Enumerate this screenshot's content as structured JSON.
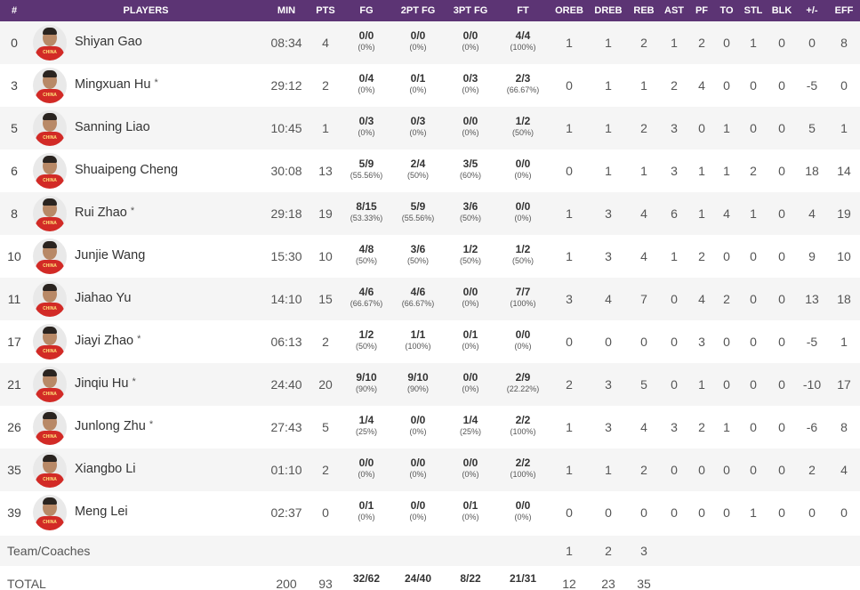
{
  "columns": [
    "#",
    "PLAYERS",
    "MIN",
    "PTS",
    "FG",
    "2PT FG",
    "3PT FG",
    "FT",
    "OREB",
    "DREB",
    "REB",
    "AST",
    "PF",
    "TO",
    "STL",
    "BLK",
    "+/-",
    "EFF"
  ],
  "players": [
    {
      "num": "0",
      "name": "Shiyan Gao",
      "star": "",
      "min": "08:34",
      "pts": "4",
      "fg": "0/0",
      "fg_pct": "(0%)",
      "fg2": "0/0",
      "fg2_pct": "(0%)",
      "fg3": "0/0",
      "fg3_pct": "(0%)",
      "ft": "4/4",
      "ft_pct": "(100%)",
      "oreb": "1",
      "dreb": "1",
      "reb": "2",
      "ast": "1",
      "pf": "2",
      "to": "0",
      "stl": "1",
      "blk": "0",
      "pm": "0",
      "eff": "8"
    },
    {
      "num": "3",
      "name": "Mingxuan Hu",
      "star": "*",
      "min": "29:12",
      "pts": "2",
      "fg": "0/4",
      "fg_pct": "(0%)",
      "fg2": "0/1",
      "fg2_pct": "(0%)",
      "fg3": "0/3",
      "fg3_pct": "(0%)",
      "ft": "2/3",
      "ft_pct": "(66.67%)",
      "oreb": "0",
      "dreb": "1",
      "reb": "1",
      "ast": "2",
      "pf": "4",
      "to": "0",
      "stl": "0",
      "blk": "0",
      "pm": "-5",
      "eff": "0"
    },
    {
      "num": "5",
      "name": "Sanning Liao",
      "star": "",
      "min": "10:45",
      "pts": "1",
      "fg": "0/3",
      "fg_pct": "(0%)",
      "fg2": "0/3",
      "fg2_pct": "(0%)",
      "fg3": "0/0",
      "fg3_pct": "(0%)",
      "ft": "1/2",
      "ft_pct": "(50%)",
      "oreb": "1",
      "dreb": "1",
      "reb": "2",
      "ast": "3",
      "pf": "0",
      "to": "1",
      "stl": "0",
      "blk": "0",
      "pm": "5",
      "eff": "1"
    },
    {
      "num": "6",
      "name": "Shuaipeng Cheng",
      "star": "",
      "min": "30:08",
      "pts": "13",
      "fg": "5/9",
      "fg_pct": "(55.56%)",
      "fg2": "2/4",
      "fg2_pct": "(50%)",
      "fg3": "3/5",
      "fg3_pct": "(60%)",
      "ft": "0/0",
      "ft_pct": "(0%)",
      "oreb": "0",
      "dreb": "1",
      "reb": "1",
      "ast": "3",
      "pf": "1",
      "to": "1",
      "stl": "2",
      "blk": "0",
      "pm": "18",
      "eff": "14"
    },
    {
      "num": "8",
      "name": "Rui Zhao",
      "star": "*",
      "min": "29:18",
      "pts": "19",
      "fg": "8/15",
      "fg_pct": "(53.33%)",
      "fg2": "5/9",
      "fg2_pct": "(55.56%)",
      "fg3": "3/6",
      "fg3_pct": "(50%)",
      "ft": "0/0",
      "ft_pct": "(0%)",
      "oreb": "1",
      "dreb": "3",
      "reb": "4",
      "ast": "6",
      "pf": "1",
      "to": "4",
      "stl": "1",
      "blk": "0",
      "pm": "4",
      "eff": "19"
    },
    {
      "num": "10",
      "name": "Junjie Wang",
      "star": "",
      "min": "15:30",
      "pts": "10",
      "fg": "4/8",
      "fg_pct": "(50%)",
      "fg2": "3/6",
      "fg2_pct": "(50%)",
      "fg3": "1/2",
      "fg3_pct": "(50%)",
      "ft": "1/2",
      "ft_pct": "(50%)",
      "oreb": "1",
      "dreb": "3",
      "reb": "4",
      "ast": "1",
      "pf": "2",
      "to": "0",
      "stl": "0",
      "blk": "0",
      "pm": "9",
      "eff": "10"
    },
    {
      "num": "11",
      "name": "Jiahao Yu",
      "star": "",
      "min": "14:10",
      "pts": "15",
      "fg": "4/6",
      "fg_pct": "(66.67%)",
      "fg2": "4/6",
      "fg2_pct": "(66.67%)",
      "fg3": "0/0",
      "fg3_pct": "(0%)",
      "ft": "7/7",
      "ft_pct": "(100%)",
      "oreb": "3",
      "dreb": "4",
      "reb": "7",
      "ast": "0",
      "pf": "4",
      "to": "2",
      "stl": "0",
      "blk": "0",
      "pm": "13",
      "eff": "18"
    },
    {
      "num": "17",
      "name": "Jiayi Zhao",
      "star": "*",
      "min": "06:13",
      "pts": "2",
      "fg": "1/2",
      "fg_pct": "(50%)",
      "fg2": "1/1",
      "fg2_pct": "(100%)",
      "fg3": "0/1",
      "fg3_pct": "(0%)",
      "ft": "0/0",
      "ft_pct": "(0%)",
      "oreb": "0",
      "dreb": "0",
      "reb": "0",
      "ast": "0",
      "pf": "3",
      "to": "0",
      "stl": "0",
      "blk": "0",
      "pm": "-5",
      "eff": "1"
    },
    {
      "num": "21",
      "name": "Jinqiu Hu",
      "star": "*",
      "min": "24:40",
      "pts": "20",
      "fg": "9/10",
      "fg_pct": "(90%)",
      "fg2": "9/10",
      "fg2_pct": "(90%)",
      "fg3": "0/0",
      "fg3_pct": "(0%)",
      "ft": "2/9",
      "ft_pct": "(22.22%)",
      "oreb": "2",
      "dreb": "3",
      "reb": "5",
      "ast": "0",
      "pf": "1",
      "to": "0",
      "stl": "0",
      "blk": "0",
      "pm": "-10",
      "eff": "17"
    },
    {
      "num": "26",
      "name": "Junlong Zhu",
      "star": "*",
      "min": "27:43",
      "pts": "5",
      "fg": "1/4",
      "fg_pct": "(25%)",
      "fg2": "0/0",
      "fg2_pct": "(0%)",
      "fg3": "1/4",
      "fg3_pct": "(25%)",
      "ft": "2/2",
      "ft_pct": "(100%)",
      "oreb": "1",
      "dreb": "3",
      "reb": "4",
      "ast": "3",
      "pf": "2",
      "to": "1",
      "stl": "0",
      "blk": "0",
      "pm": "-6",
      "eff": "8"
    },
    {
      "num": "35",
      "name": "Xiangbo Li",
      "star": "",
      "min": "01:10",
      "pts": "2",
      "fg": "0/0",
      "fg_pct": "(0%)",
      "fg2": "0/0",
      "fg2_pct": "(0%)",
      "fg3": "0/0",
      "fg3_pct": "(0%)",
      "ft": "2/2",
      "ft_pct": "(100%)",
      "oreb": "1",
      "dreb": "1",
      "reb": "2",
      "ast": "0",
      "pf": "0",
      "to": "0",
      "stl": "0",
      "blk": "0",
      "pm": "2",
      "eff": "4"
    },
    {
      "num": "39",
      "name": "Meng Lei",
      "star": "",
      "min": "02:37",
      "pts": "0",
      "fg": "0/1",
      "fg_pct": "(0%)",
      "fg2": "0/0",
      "fg2_pct": "(0%)",
      "fg3": "0/1",
      "fg3_pct": "(0%)",
      "ft": "0/0",
      "ft_pct": "(0%)",
      "oreb": "0",
      "dreb": "0",
      "reb": "0",
      "ast": "0",
      "pf": "0",
      "to": "0",
      "stl": "1",
      "blk": "0",
      "pm": "0",
      "eff": "0"
    }
  ],
  "avatar_text": "CHINA",
  "team_row": {
    "label": "Team/Coaches",
    "oreb": "1",
    "dreb": "2",
    "reb": "3"
  },
  "total_row": {
    "label": "TOTAL",
    "min": "200",
    "pts": "93",
    "fg": "32/62",
    "fg2": "24/40",
    "fg3": "8/22",
    "ft": "21/31",
    "oreb": "12",
    "dreb": "23",
    "reb": "35"
  },
  "colors": {
    "header_bg": "#5c3474",
    "jersey": "#d22a26"
  }
}
